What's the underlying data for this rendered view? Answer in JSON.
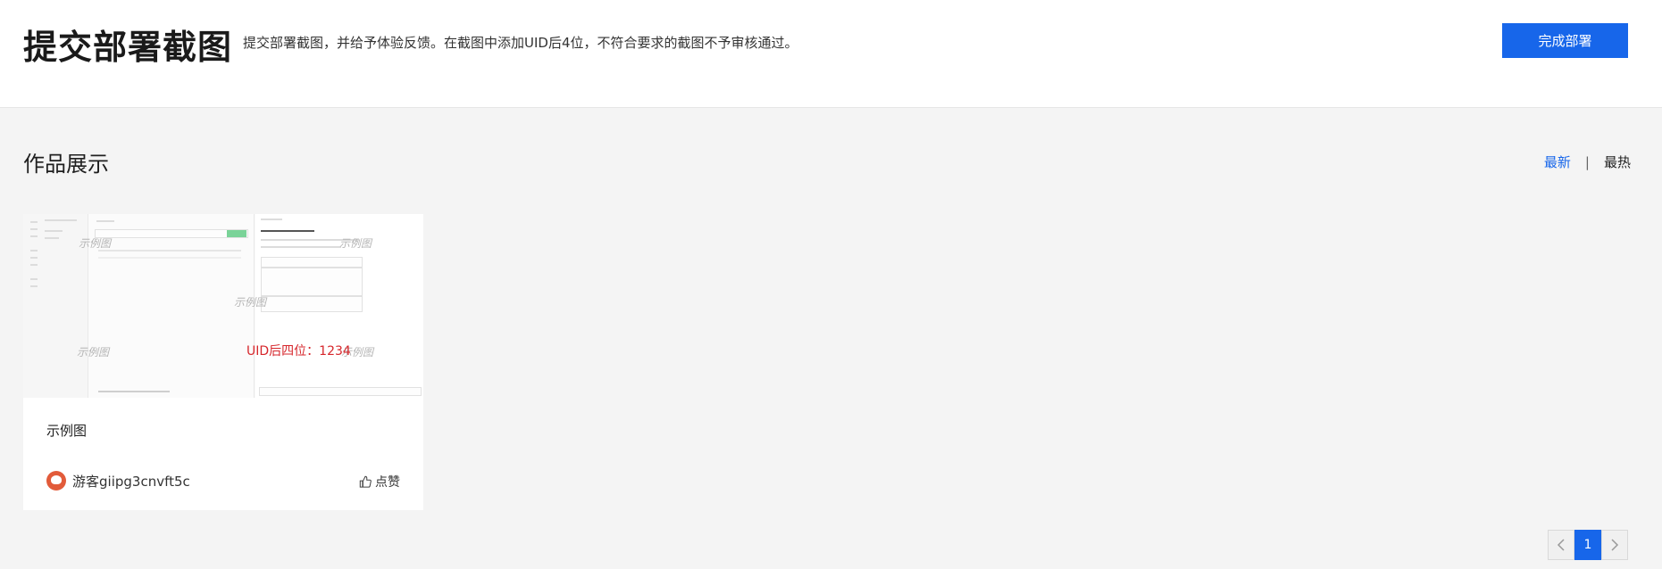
{
  "header": {
    "title": "提交部署截图",
    "description": "提交部署截图，并给予体验反馈。在截图中添加UID后4位，不符合要求的截图不予审核通过。",
    "done_button": "完成部署"
  },
  "gallery": {
    "title": "作品展示",
    "sort_new": "最新",
    "sort_separator": "|",
    "sort_hot": "最热"
  },
  "card": {
    "image_watermark": "示例图",
    "uid_overlay": "UID后四位：1234",
    "title": "示例图",
    "author": "游客giipg3cnvft5c",
    "like_label": "点赞"
  },
  "pagination": {
    "current_page": "1"
  },
  "colors": {
    "accent": "#1766ea",
    "uid_text": "#d6262b"
  },
  "icons": {
    "prev": "chevron-left-icon",
    "next": "chevron-right-icon",
    "like": "thumbs-up-icon"
  }
}
